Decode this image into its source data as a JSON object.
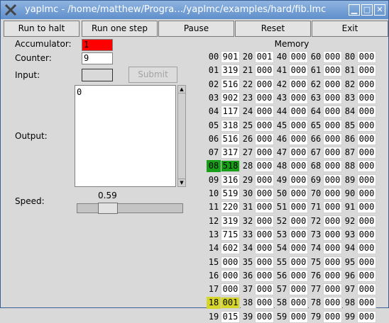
{
  "window": {
    "title": "yaplmc - /home/matthew/Progra…/yaplmc/examples/hard/fib.lmc"
  },
  "toolbar": [
    "Run to halt",
    "Run one step",
    "Pause",
    "Reset",
    "Exit"
  ],
  "accumulator": {
    "label": "Accumulator:",
    "value": "1",
    "color": "#ff0000"
  },
  "counter": {
    "label": "Counter:",
    "value": "9"
  },
  "input": {
    "label": "Input:",
    "value": "",
    "submit_label": "Submit"
  },
  "output": {
    "label": "Output:",
    "value": "0"
  },
  "speed": {
    "label": "Speed:",
    "value": "0.59"
  },
  "memory": {
    "title": "Memory",
    "highlight_program_counter": "#179f17",
    "highlight_last_access": "#d6d62a",
    "addresses": [
      "00",
      "01",
      "02",
      "03",
      "04",
      "05",
      "06",
      "07",
      "08",
      "09",
      "10",
      "11",
      "12",
      "13",
      "14",
      "15",
      "16",
      "17",
      "18",
      "19",
      "20",
      "21",
      "22",
      "23",
      "24",
      "25",
      "26",
      "27",
      "28",
      "29",
      "30",
      "31",
      "32",
      "33",
      "34",
      "35",
      "36",
      "37",
      "38",
      "39",
      "40",
      "41",
      "42",
      "43",
      "44",
      "45",
      "46",
      "47",
      "48",
      "49",
      "50",
      "51",
      "52",
      "53",
      "54",
      "55",
      "56",
      "57",
      "58",
      "59",
      "60",
      "61",
      "62",
      "63",
      "64",
      "65",
      "66",
      "67",
      "68",
      "69",
      "70",
      "71",
      "72",
      "73",
      "74",
      "75",
      "76",
      "77",
      "78",
      "79",
      "80",
      "81",
      "82",
      "83",
      "84",
      "85",
      "86",
      "87",
      "88",
      "89",
      "90",
      "91",
      "92",
      "93",
      "94",
      "95",
      "96",
      "97",
      "98",
      "99"
    ],
    "values": [
      "901",
      "319",
      "516",
      "902",
      "117",
      "318",
      "516",
      "317",
      "518",
      "316",
      "519",
      "220",
      "319",
      "715",
      "602",
      "000",
      "000",
      "000",
      "001",
      "015",
      "001",
      "000",
      "000",
      "000",
      "000",
      "000",
      "000",
      "000",
      "000",
      "000",
      "000",
      "000",
      "000",
      "000",
      "000",
      "000",
      "000",
      "000",
      "000",
      "000",
      "000",
      "000",
      "000",
      "000",
      "000",
      "000",
      "000",
      "000",
      "000",
      "000",
      "000",
      "000",
      "000",
      "000",
      "000",
      "000",
      "000",
      "000",
      "000",
      "000",
      "000",
      "000",
      "000",
      "000",
      "000",
      "000",
      "000",
      "000",
      "000",
      "000",
      "000",
      "000",
      "000",
      "000",
      "000",
      "000",
      "000",
      "000",
      "000",
      "000",
      "000",
      "000",
      "000",
      "000",
      "000",
      "000",
      "000",
      "000",
      "000",
      "000",
      "000",
      "000",
      "000",
      "000",
      "000",
      "000",
      "000",
      "000",
      "000",
      "000"
    ],
    "pc_index": 8,
    "last_index": 18
  }
}
